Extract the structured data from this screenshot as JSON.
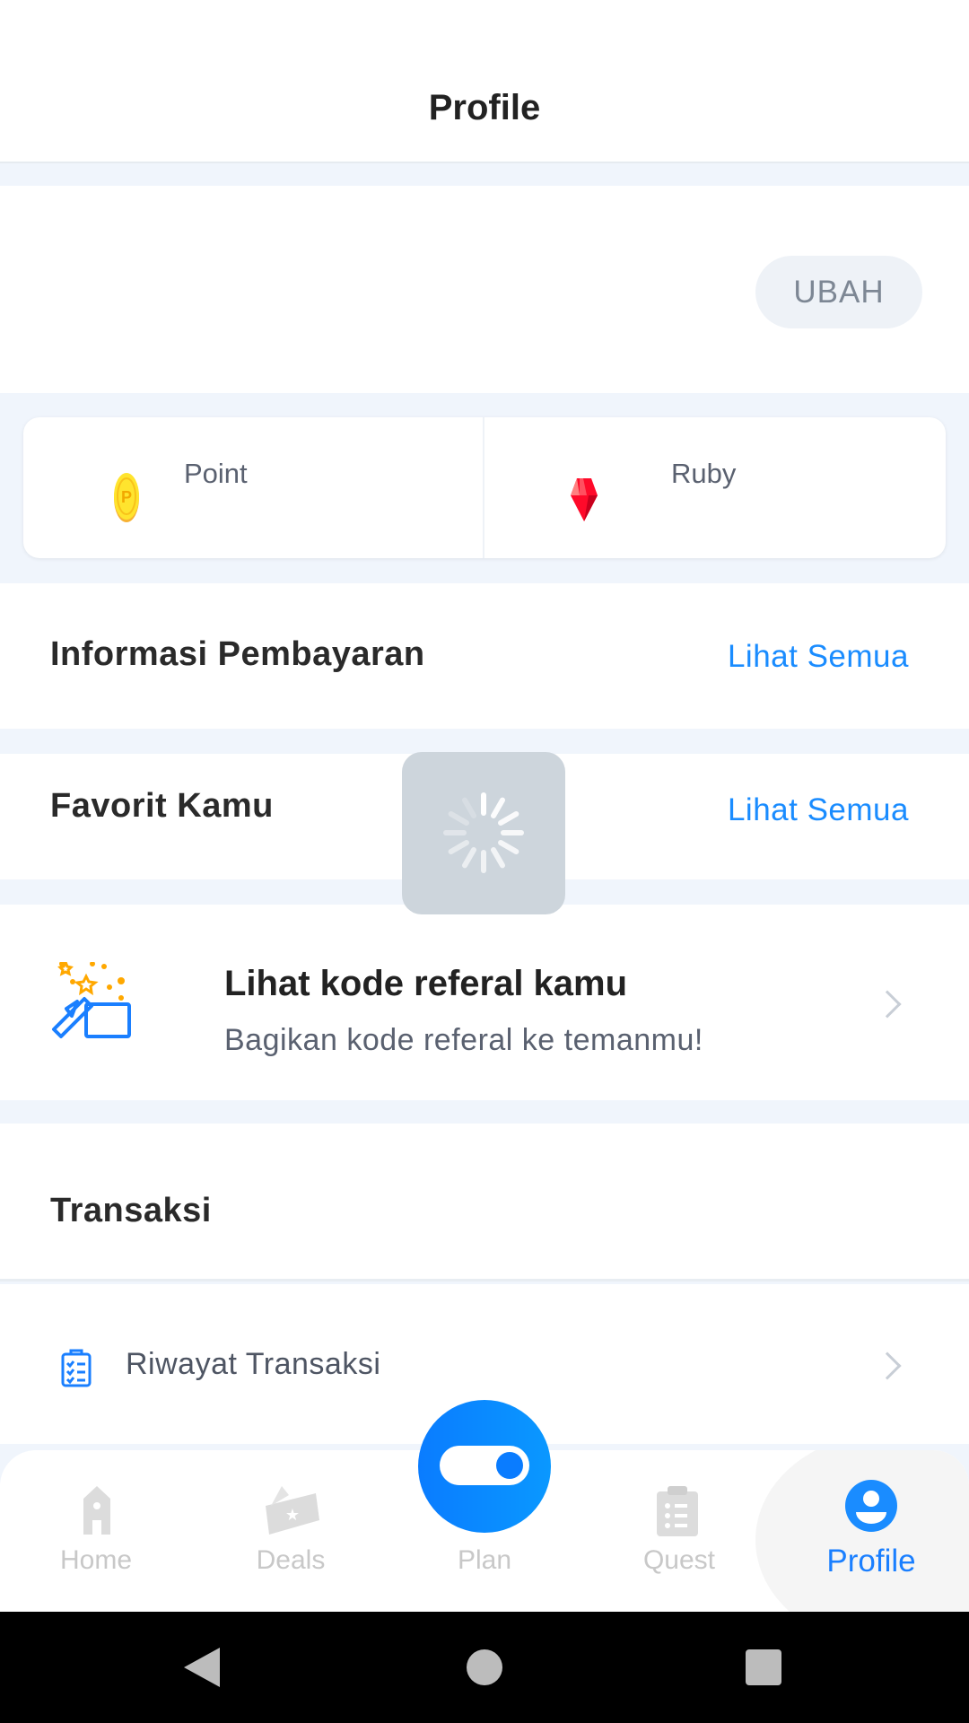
{
  "header": {
    "title": "Profile"
  },
  "profile": {
    "edit_label": "UBAH"
  },
  "wallet": {
    "point_label": "Point",
    "ruby_label": "Ruby"
  },
  "payment": {
    "title": "Informasi Pembayaran",
    "see_all": "Lihat Semua"
  },
  "favorites": {
    "title": "Favorit Kamu",
    "see_all": "Lihat Semua"
  },
  "referral": {
    "title": "Lihat kode referal kamu",
    "subtitle": "Bagikan kode referal ke temanmu!"
  },
  "transactions": {
    "title": "Transaksi",
    "items": [
      {
        "label": "Riwayat Transaksi",
        "icon": "clipboard-check-icon"
      }
    ]
  },
  "bottom_nav": {
    "active": "Profile",
    "items": [
      {
        "label": "Home",
        "icon": "home-icon"
      },
      {
        "label": "Deals",
        "icon": "ticket-icon"
      },
      {
        "label": "Plan",
        "icon": "toggle-icon"
      },
      {
        "label": "Quest",
        "icon": "clipboard-icon"
      },
      {
        "label": "Profile",
        "icon": "user-icon"
      }
    ]
  },
  "colors": {
    "accent": "#1a8cff",
    "background": "#f0f5fc",
    "inactive": "#c8c8c8"
  }
}
